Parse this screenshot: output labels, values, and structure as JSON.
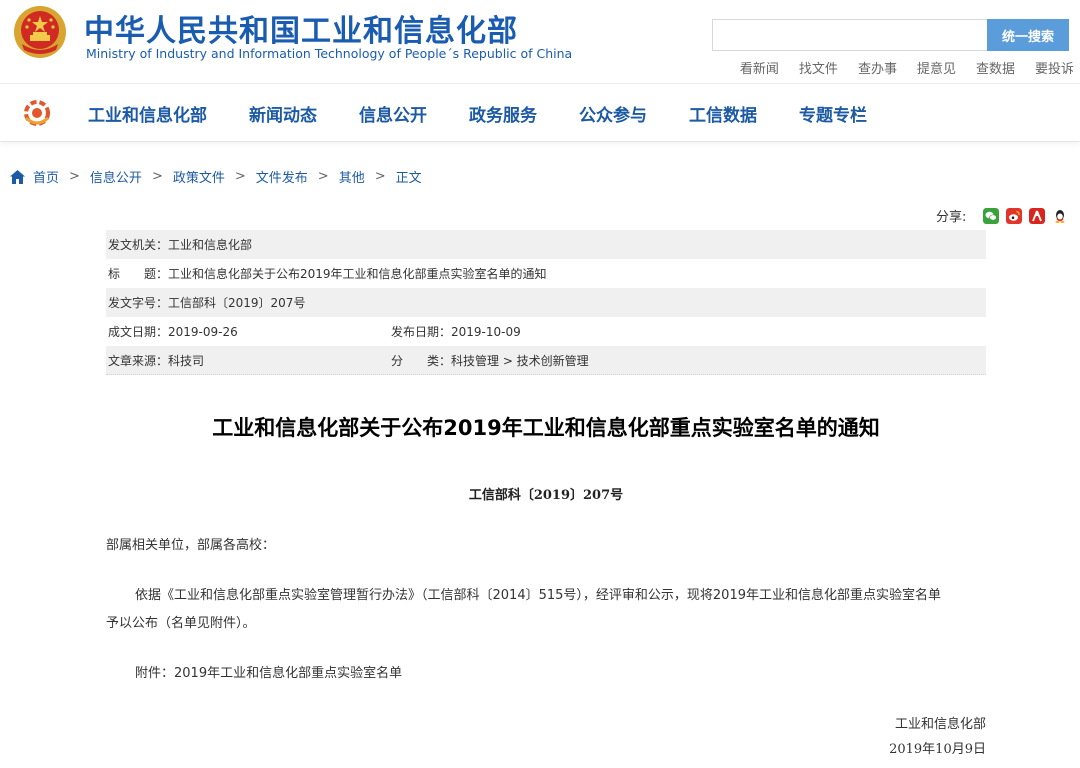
{
  "header": {
    "title": "中华人民共和国工业和信息化部",
    "subtitle": "Ministry of Industry and Information Technology of People´s Republic of China",
    "search_placeholder": "",
    "search_button": "统一搜索",
    "quick_links": [
      "看新闻",
      "找文件",
      "查办事",
      "提意见",
      "查数据",
      "要投诉"
    ]
  },
  "nav": {
    "items": [
      "工业和信息化部",
      "新闻动态",
      "信息公开",
      "政务服务",
      "公众参与",
      "工信数据",
      "专题专栏"
    ]
  },
  "breadcrumb": {
    "items": [
      "首页",
      "信息公开",
      "政策文件",
      "文件发布",
      "其他",
      "正文"
    ],
    "separator": ">"
  },
  "share": {
    "label": "分享:",
    "icons": [
      "wechat-icon",
      "weibo-icon",
      "renren-icon",
      "qq-icon"
    ]
  },
  "meta": {
    "issuer": "发文机关：工业和信息化部",
    "title": "标　　题：工业和信息化部关于公布2019年工业和信息化部重点实验室名单的通知",
    "doc_number": "发文字号：工信部科〔2019〕207号",
    "created_date": "成文日期：2019-09-26",
    "published_date": "发布日期：2019-10-09",
    "source": "文章来源：科技司",
    "category": "分　　类：科技管理 > 技术创新管理"
  },
  "article": {
    "title": "工业和信息化部关于公布2019年工业和信息化部重点实验室名单的通知",
    "doc_number": "工信部科〔2019〕207号",
    "greeting": "部属相关单位，部属各高校：",
    "paragraph_line1": "依据《工业和信息化部重点实验室管理暂行办法》（工信部科〔2014〕515号），经评审和公示，现将2019年工业和信息化部重点实验室名单",
    "paragraph_line2": "予以公布（名单见附件）。",
    "attachment": "附件：2019年工业和信息化部重点实验室名单",
    "signature_org": "工业和信息化部",
    "signature_date": "2019年10月9日"
  },
  "colors": {
    "brand_blue": "#1d5aa6",
    "search_button": "#5b9cdb",
    "meta_shade": "#f0f0f0"
  }
}
